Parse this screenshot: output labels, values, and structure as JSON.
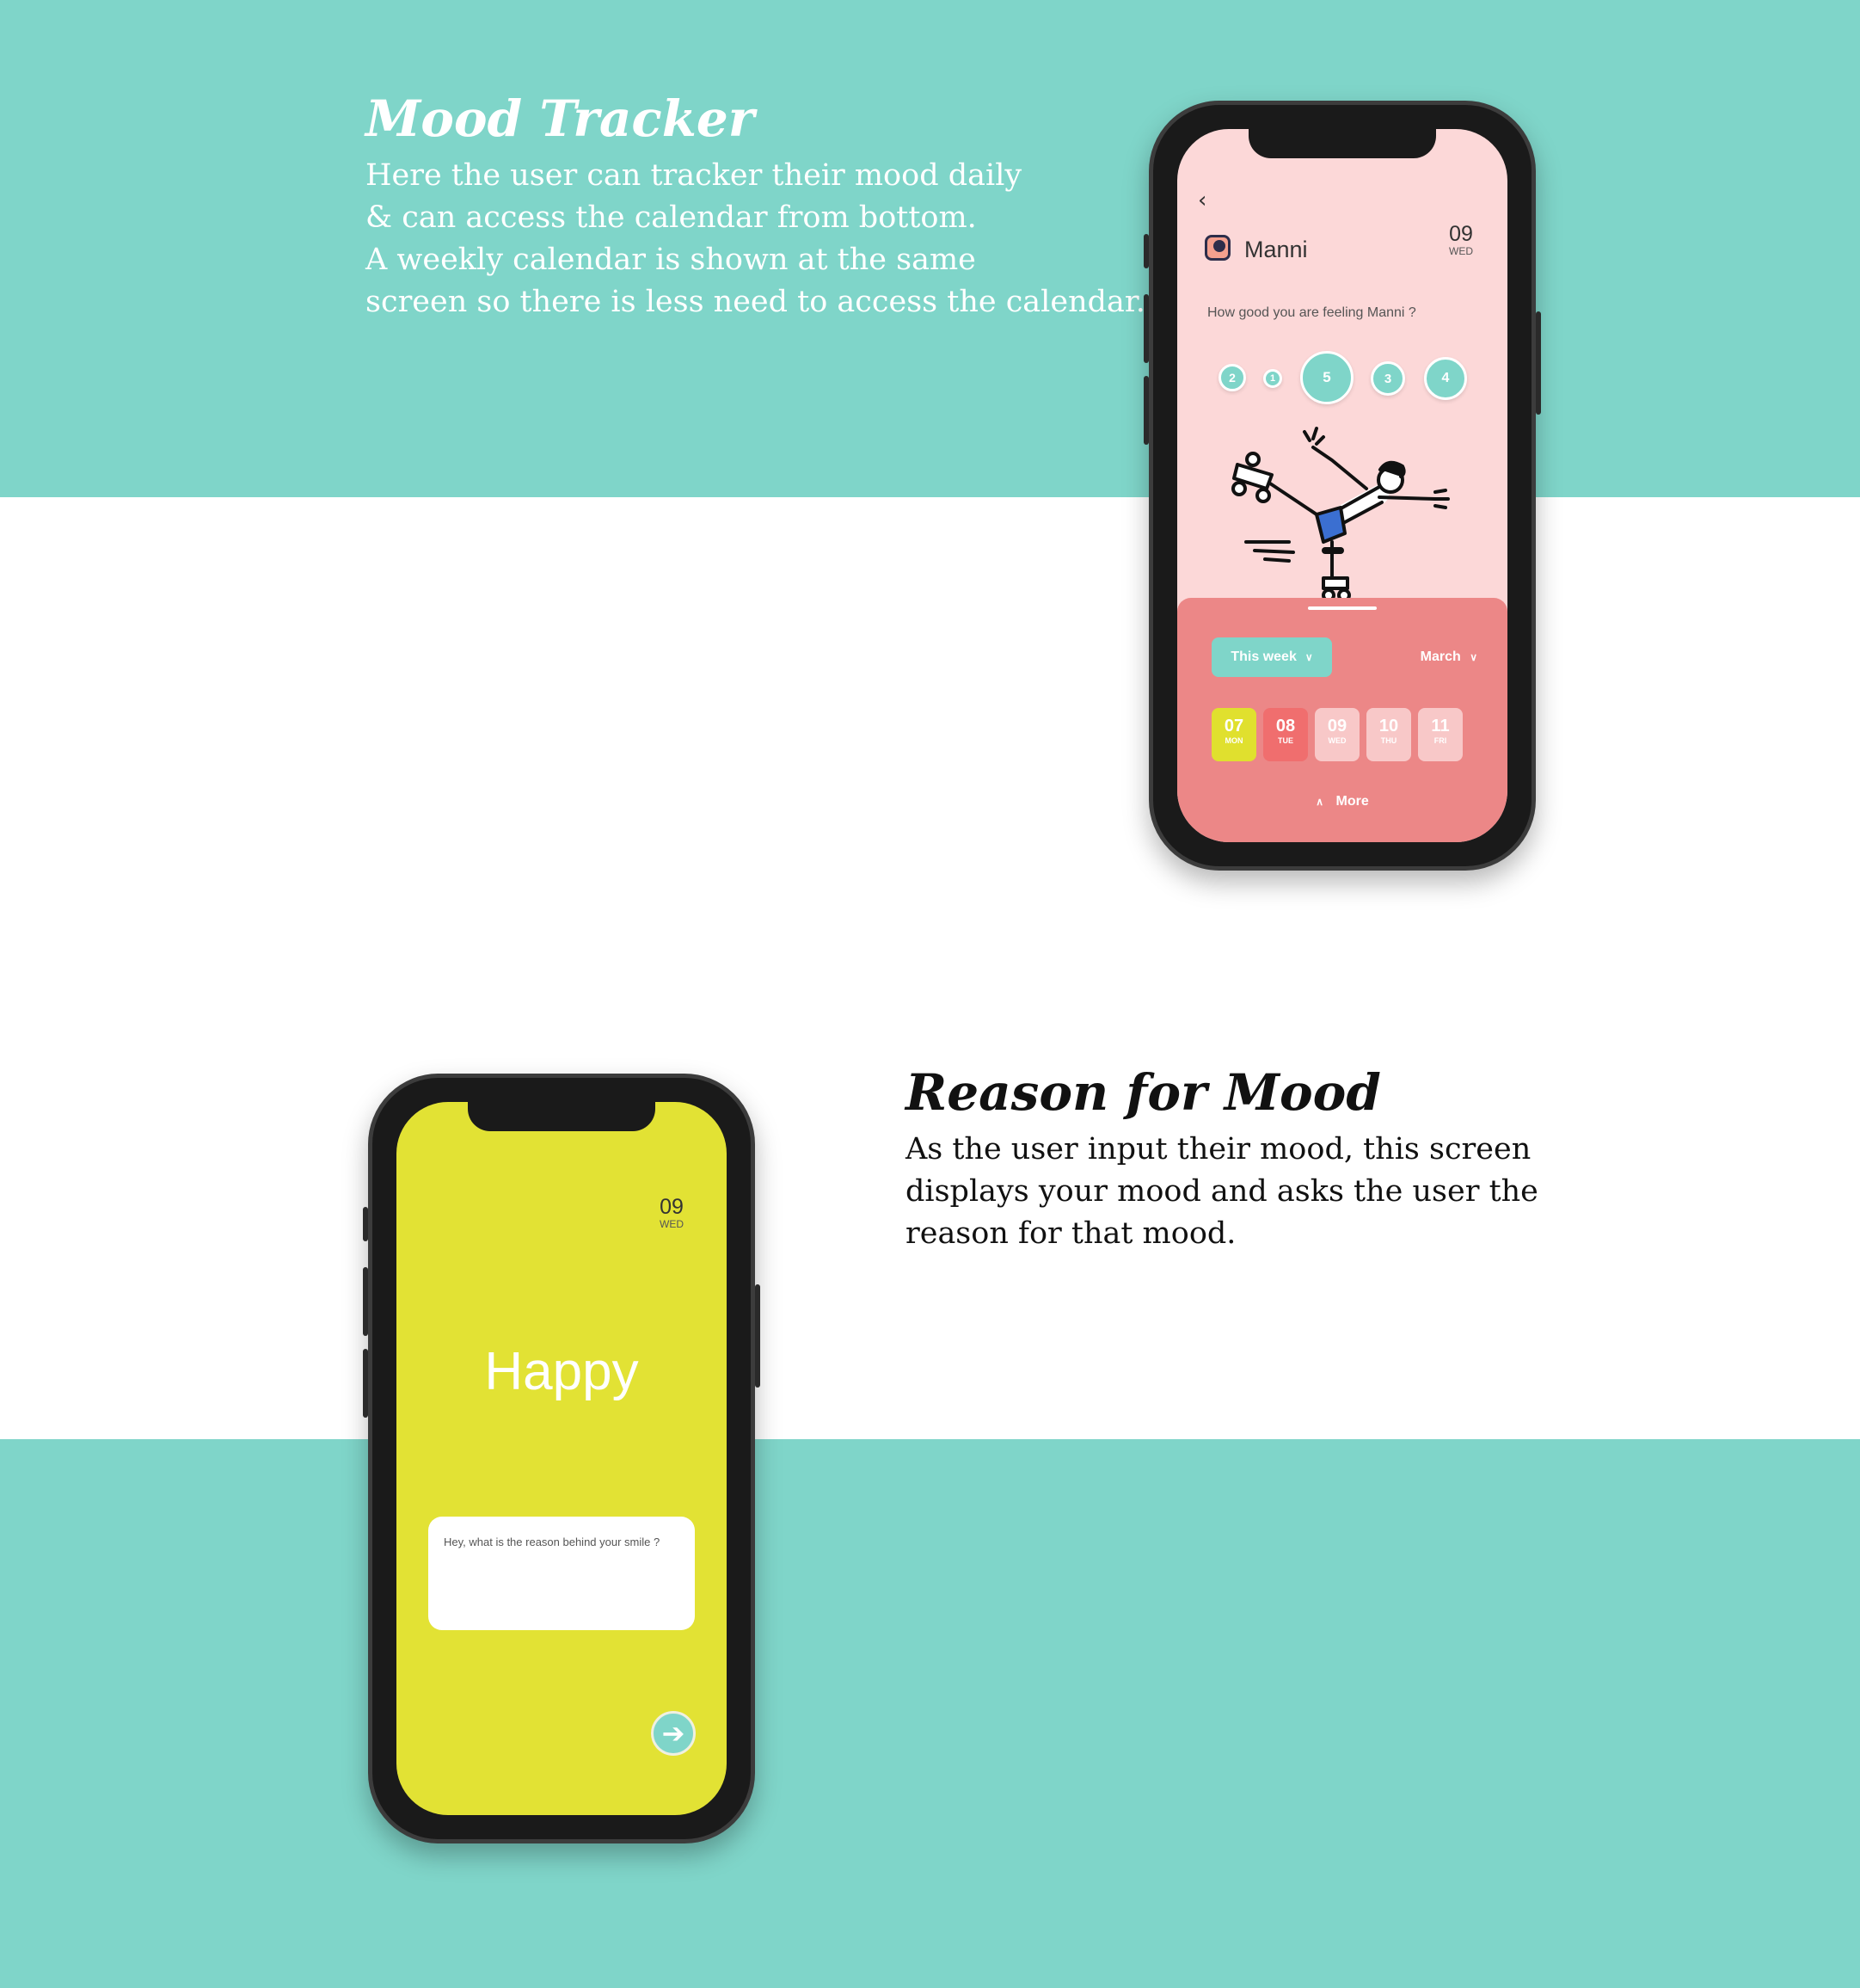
{
  "section1": {
    "heading": "Mood Tracker",
    "lines": [
      "Here the user can tracker their mood daily",
      "& can access the calendar from bottom.",
      "A weekly calendar is shown at the same",
      "screen so there is less need to access the calendar."
    ]
  },
  "section2": {
    "heading": "Reason for Mood",
    "lines": [
      "As the user input their mood, this screen",
      "displays your mood and asks the user the",
      "reason for that mood."
    ]
  },
  "screen1": {
    "back_icon": "chevron-left-icon",
    "user_name": "Manni",
    "date": {
      "day": "09",
      "weekday": "WED"
    },
    "question": "How good you are feeling Manni ?",
    "mood_options": [
      "2",
      "1",
      "5",
      "3",
      "4"
    ],
    "week_filter": "This week",
    "month_filter": "March",
    "days": [
      {
        "num": "07",
        "weekday": "MON"
      },
      {
        "num": "08",
        "weekday": "TUE"
      },
      {
        "num": "09",
        "weekday": "WED"
      },
      {
        "num": "10",
        "weekday": "THU"
      },
      {
        "num": "11",
        "weekday": "FRI"
      }
    ],
    "more_label": "More"
  },
  "screen2": {
    "date": {
      "day": "09",
      "weekday": "WED"
    },
    "mood": "Happy",
    "reason_placeholder": "Hey, what is the reason behind your smile ?",
    "next_icon": "arrow-right-icon"
  },
  "colors": {
    "teal": "#7fd5c9",
    "pink": "#fcd8d8",
    "coral": "#ec8787",
    "yellow": "#e2e234",
    "lime_chip": "#e0e02e"
  }
}
